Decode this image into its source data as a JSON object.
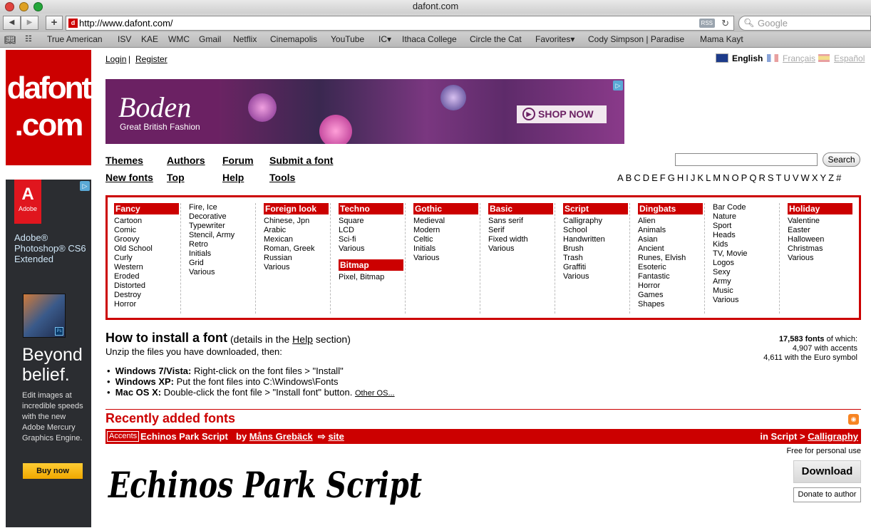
{
  "window": {
    "title": "dafont.com"
  },
  "browser": {
    "url": "http://www.dafont.com/",
    "rss_label": "RSS",
    "search_placeholder": "Google",
    "bookmarks": [
      "True American",
      "ISV",
      "KAE",
      "WMC",
      "Gmail",
      "Netflix",
      "Cinemapolis",
      "YouTube",
      "IC▾",
      "Ithaca College",
      "Circle the Cat",
      "Favorites▾",
      "Cody Simpson | Paradise",
      "Mama Kayt"
    ]
  },
  "site": {
    "logo_line1": "dafont",
    "logo_line2": ".com",
    "login": "Login",
    "separator": "|",
    "register": "Register",
    "languages": [
      "English",
      "Français",
      "Español"
    ]
  },
  "banner": {
    "brand": "Boden",
    "tagline": "Great British Fashion",
    "cta": "SHOP NOW"
  },
  "left_ad": {
    "brand": "Adobe",
    "product": "Adobe® Photoshop® CS6 Extended",
    "headline1": "Beyond",
    "headline2": "belief.",
    "body": "Edit images at incredible speeds with the new Adobe Mercury Graphics Engine.",
    "cta": "Buy now"
  },
  "nav": {
    "row1": [
      "Themes",
      "Authors",
      "Forum",
      "Submit a font"
    ],
    "row2": [
      "New fonts",
      "Top",
      "Help",
      "Tools"
    ],
    "search_button": "Search",
    "alphabet": [
      "A",
      "B",
      "C",
      "D",
      "E",
      "F",
      "G",
      "H",
      "I",
      "J",
      "K",
      "L",
      "M",
      "N",
      "O",
      "P",
      "Q",
      "R",
      "S",
      "T",
      "U",
      "V",
      "W",
      "X",
      "Y",
      "Z",
      "#"
    ]
  },
  "categories": [
    {
      "title": "Fancy",
      "items": [
        "Cartoon",
        "Comic",
        "Groovy",
        "Old School",
        "Curly",
        "Western",
        "Eroded",
        "Distorted",
        "Destroy",
        "Horror"
      ]
    },
    {
      "title": "",
      "items": [
        "Fire, Ice",
        "Decorative",
        "Typewriter",
        "Stencil, Army",
        "Retro",
        "Initials",
        "Grid",
        "Various"
      ]
    },
    {
      "title": "Foreign look",
      "items": [
        "Chinese, Jpn",
        "Arabic",
        "Mexican",
        "Roman, Greek",
        "Russian",
        "Various"
      ]
    },
    {
      "title": "Techno",
      "items": [
        "Square",
        "LCD",
        "Sci-fi",
        "Various"
      ],
      "title2": "Bitmap",
      "items2": [
        "Pixel, Bitmap"
      ]
    },
    {
      "title": "Gothic",
      "items": [
        "Medieval",
        "Modern",
        "Celtic",
        "Initials",
        "Various"
      ]
    },
    {
      "title": "Basic",
      "items": [
        "Sans serif",
        "Serif",
        "Fixed width",
        "Various"
      ]
    },
    {
      "title": "Script",
      "items": [
        "Calligraphy",
        "School",
        "Handwritten",
        "Brush",
        "Trash",
        "Graffiti",
        "Various"
      ]
    },
    {
      "title": "Dingbats",
      "items": [
        "Alien",
        "Animals",
        "Asian",
        "Ancient",
        "Runes, Elvish",
        "Esoteric",
        "Fantastic",
        "Horror",
        "Games",
        "Shapes"
      ]
    },
    {
      "title": "",
      "items": [
        "Bar Code",
        "Nature",
        "Sport",
        "Heads",
        "Kids",
        "TV, Movie",
        "Logos",
        "Sexy",
        "Army",
        "Music",
        "Various"
      ]
    },
    {
      "title": "Holiday",
      "items": [
        "Valentine",
        "Easter",
        "Halloween",
        "Christmas",
        "Various"
      ]
    }
  ],
  "install": {
    "title": "How to install a font",
    "note_pre": "(details in the",
    "note_link": "Help",
    "note_post": "section)",
    "intro": "Unzip the files you have downloaded, then:",
    "steps": [
      {
        "os": "Windows 7/Vista:",
        "text": " Right-click on the font files > \"Install\""
      },
      {
        "os": "Windows XP:",
        "text": " Put the font files into C:\\Windows\\Fonts"
      },
      {
        "os": "Mac OS X:",
        "text": " Double-click the font file > \"Install font\" button. "
      }
    ],
    "other_os": "Other OS..."
  },
  "stats": {
    "count": "17,583 fonts",
    "suffix": " of which:",
    "accents": "4,907 with accents",
    "euro": "4,611 with the Euro symbol"
  },
  "recent": {
    "title": "Recently added fonts",
    "tag": "Accents",
    "font_name": "Echinos Park Script",
    "by": "by",
    "author": "Måns Grebäck",
    "site": "site",
    "in_label": "in Script >",
    "category": "Calligraphy",
    "license": "Free for personal use",
    "download": "Download",
    "donate": "Donate to author",
    "sample": "Echinos Park Script"
  }
}
